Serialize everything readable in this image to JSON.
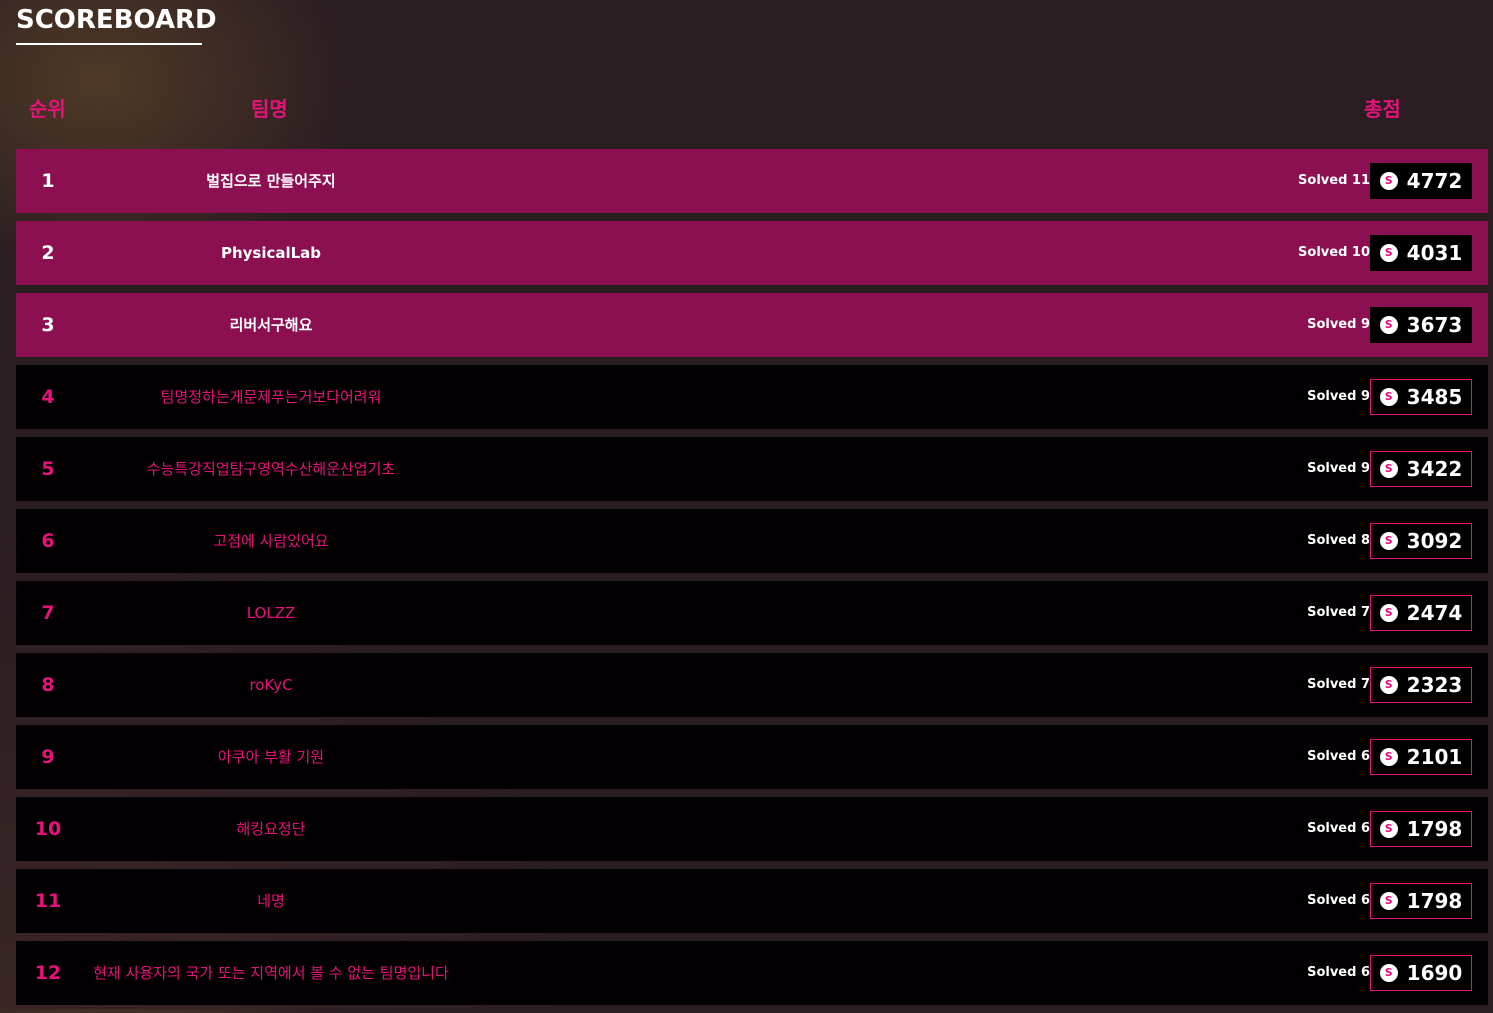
{
  "page": {
    "title": "SCOREBOARD"
  },
  "headers": {
    "rank": "순위",
    "team": "팀명",
    "total": "총점"
  },
  "icons": {
    "coin": "S"
  },
  "colors": {
    "accent": "#e6127a",
    "top_row": "#8c0f52",
    "row": "#020002",
    "background": "#2a1d22"
  },
  "rows": [
    {
      "rank": "1",
      "team": "벌집으로 만들어주지",
      "solved": "Solved 11",
      "score": "4772",
      "highlight": true
    },
    {
      "rank": "2",
      "team": "PhysicalLab",
      "solved": "Solved 10",
      "score": "4031",
      "highlight": true
    },
    {
      "rank": "3",
      "team": "리버서구해요",
      "solved": "Solved 9",
      "score": "3673",
      "highlight": true
    },
    {
      "rank": "4",
      "team": "팀명정하는게문제푸는거보다어려워",
      "solved": "Solved 9",
      "score": "3485",
      "highlight": false
    },
    {
      "rank": "5",
      "team": "수능특강직업탐구영역수산해운산업기초",
      "solved": "Solved 9",
      "score": "3422",
      "highlight": false
    },
    {
      "rank": "6",
      "team": "고점에 사람있어요",
      "solved": "Solved 8",
      "score": "3092",
      "highlight": false
    },
    {
      "rank": "7",
      "team": "LOLZZ",
      "solved": "Solved 7",
      "score": "2474",
      "highlight": false
    },
    {
      "rank": "8",
      "team": "roKyC",
      "solved": "Solved 7",
      "score": "2323",
      "highlight": false
    },
    {
      "rank": "9",
      "team": "아쿠아 부활 기원",
      "solved": "Solved 6",
      "score": "2101",
      "highlight": false
    },
    {
      "rank": "10",
      "team": "해킹요정단",
      "solved": "Solved 6",
      "score": "1798",
      "highlight": false
    },
    {
      "rank": "11",
      "team": "네명",
      "solved": "Solved 6",
      "score": "1798",
      "highlight": false
    },
    {
      "rank": "12",
      "team": "현재 사용자의 국가 또는 지역에서 볼 수 없는 팀명입니다",
      "solved": "Solved 6",
      "score": "1690",
      "highlight": false
    }
  ]
}
